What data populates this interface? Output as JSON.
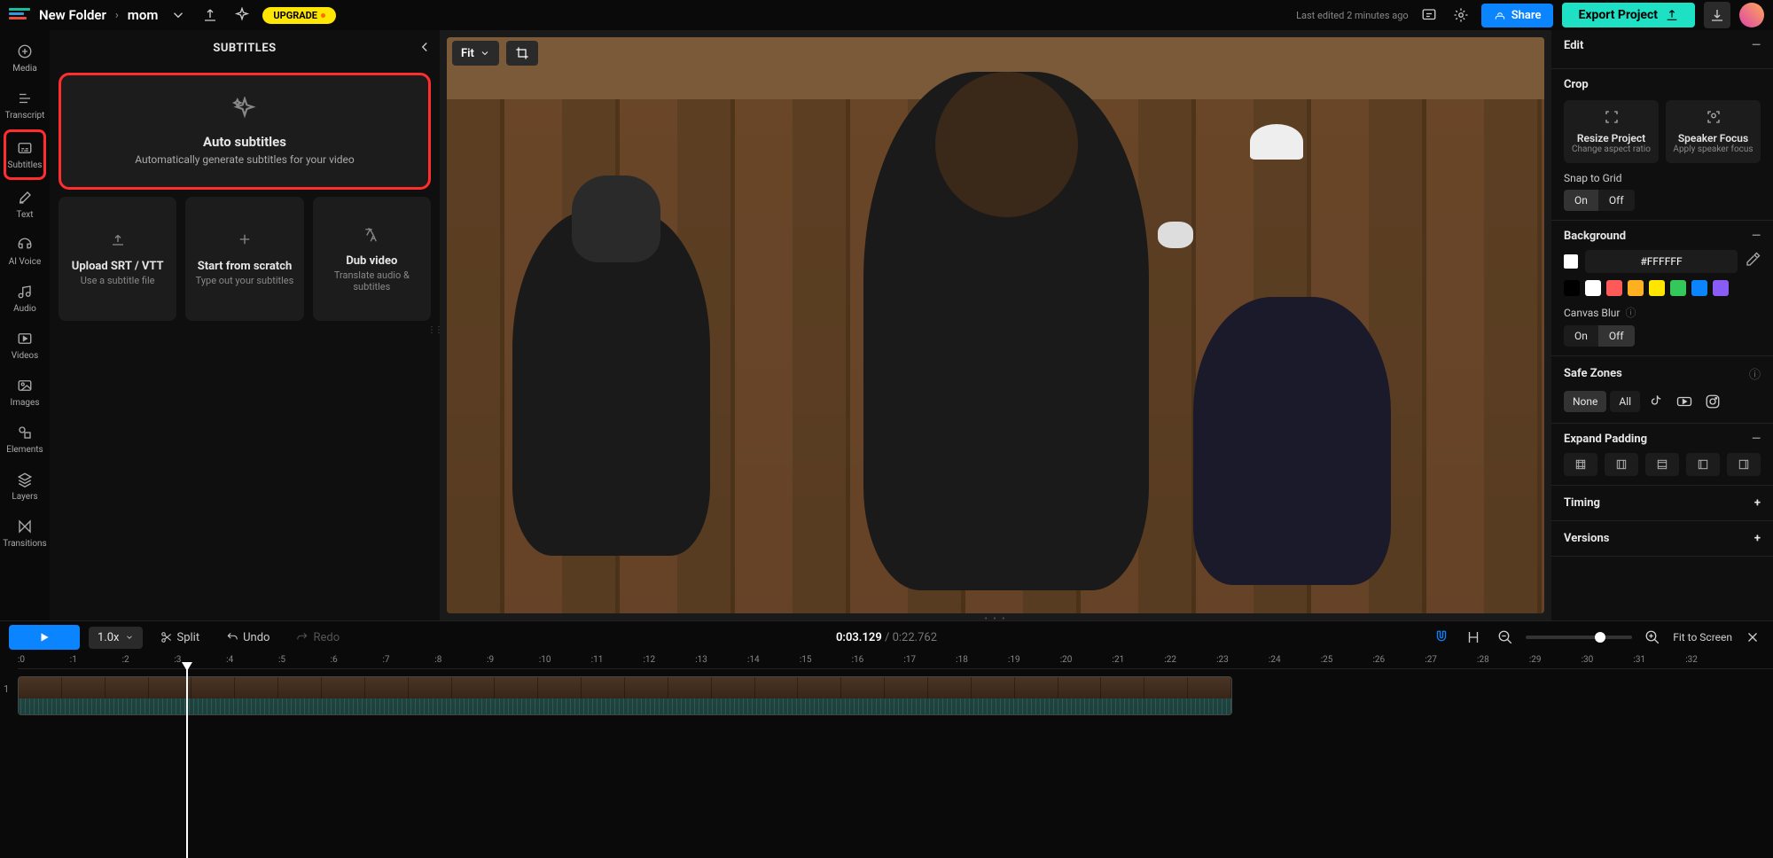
{
  "breadcrumb": {
    "folder": "New Folder",
    "project": "mom"
  },
  "topbar": {
    "upgrade": "UPGRADE",
    "last_edited": "Last edited 2 minutes ago",
    "share": "Share",
    "export": "Export Project"
  },
  "rail": {
    "items": [
      {
        "key": "media",
        "label": "Media"
      },
      {
        "key": "transcript",
        "label": "Transcript"
      },
      {
        "key": "subtitles",
        "label": "Subtitles"
      },
      {
        "key": "text",
        "label": "Text"
      },
      {
        "key": "aivoice",
        "label": "AI Voice"
      },
      {
        "key": "audio",
        "label": "Audio"
      },
      {
        "key": "videos",
        "label": "Videos"
      },
      {
        "key": "images",
        "label": "Images"
      },
      {
        "key": "elements",
        "label": "Elements"
      },
      {
        "key": "layers",
        "label": "Layers"
      },
      {
        "key": "transitions",
        "label": "Transitions"
      }
    ]
  },
  "subpanel": {
    "title": "SUBTITLES",
    "auto": {
      "title": "Auto subtitles",
      "sub": "Automatically generate subtitles for your video"
    },
    "upload": {
      "title": "Upload SRT / VTT",
      "sub": "Use a subtitle file"
    },
    "scratch": {
      "title": "Start from scratch",
      "sub": "Type out your subtitles"
    },
    "dub": {
      "title": "Dub video",
      "sub": "Translate audio & subtitles"
    }
  },
  "canvas": {
    "fit": "Fit"
  },
  "rpanel": {
    "edit": "Edit",
    "crop": {
      "title": "Crop",
      "resize": {
        "t": "Resize Project",
        "s": "Change aspect ratio"
      },
      "speaker": {
        "t": "Speaker Focus",
        "s": "Apply speaker focus"
      },
      "snap": "Snap to Grid",
      "snap_on": "On",
      "snap_off": "Off"
    },
    "bg": {
      "title": "Background",
      "hex": "#FFFFFF",
      "swatches": [
        "#000000",
        "#ffffff",
        "#ff5a5a",
        "#ffb020",
        "#ffe600",
        "#34c759",
        "#0a84ff",
        "#8a5cf6"
      ],
      "blur": "Canvas Blur",
      "blur_on": "On",
      "blur_off": "Off"
    },
    "safe": {
      "title": "Safe Zones",
      "none": "None",
      "all": "All"
    },
    "padding": {
      "title": "Expand Padding"
    },
    "timing": "Timing",
    "versions": "Versions"
  },
  "timeline": {
    "speed": "1.0x",
    "split": "Split",
    "undo": "Undo",
    "redo": "Redo",
    "current": "0:03.129",
    "duration": "0:22.762",
    "fit_screen": "Fit to Screen",
    "ticks": [
      ":0",
      ":1",
      ":2",
      ":3",
      ":4",
      ":5",
      ":6",
      ":7",
      ":8",
      ":9",
      ":10",
      ":11",
      ":12",
      ":13",
      ":14",
      ":15",
      ":16",
      ":17",
      ":18",
      ":19",
      ":20",
      ":21",
      ":22",
      ":23",
      ":24",
      ":25",
      ":26",
      ":27",
      ":28",
      ":29",
      ":30",
      ":31",
      ":32"
    ],
    "track_num": "1"
  }
}
